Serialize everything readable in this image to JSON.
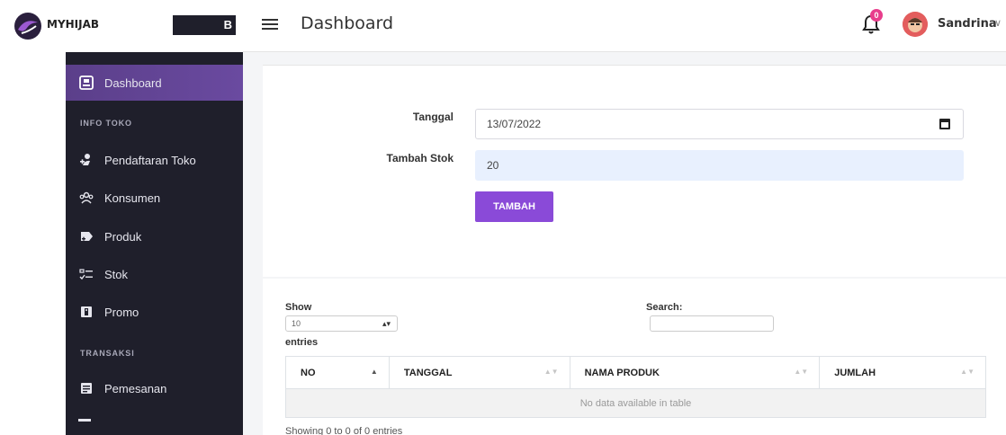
{
  "header": {
    "brand_name": "MYHIJAB",
    "store_name": "B LAMSEL",
    "page_title": "Dashboard",
    "notification_count": "0",
    "user_name": "Sandrina"
  },
  "sidebar": {
    "items": [
      {
        "label": "Dashboard",
        "icon": "dashboard-icon",
        "active": true
      },
      {
        "label": "Pendaftaran Toko",
        "icon": "user-plus-icon"
      },
      {
        "label": "Konsumen",
        "icon": "users-icon"
      },
      {
        "label": "Produk",
        "icon": "product-icon"
      },
      {
        "label": "Stok",
        "icon": "list-check-icon"
      },
      {
        "label": "Promo",
        "icon": "promo-icon"
      },
      {
        "label": "Pemesanan",
        "icon": "order-icon"
      }
    ],
    "sections": [
      "INFO TOKO",
      "TRANSAKSI"
    ]
  },
  "form": {
    "date_label": "Tanggal",
    "date_value": "13/07/2022",
    "stock_label": "Tambah Stok",
    "stock_value": "20",
    "submit_label": "TAMBAH"
  },
  "table": {
    "show_label": "Show",
    "page_size": "10",
    "entries_label": "entries",
    "search_label": "Search:",
    "columns": [
      "NO",
      "TANGGAL",
      "NAMA PRODUK",
      "JUMLAH"
    ],
    "empty_message": "No data available in table",
    "info": "Showing 0 to 0 of 0 entries"
  },
  "colors": {
    "sidebar_bg": "#1f1f2b",
    "active_item": "#5b3f8a",
    "accent": "#8a4ad8",
    "badge": "#e83e8c"
  }
}
